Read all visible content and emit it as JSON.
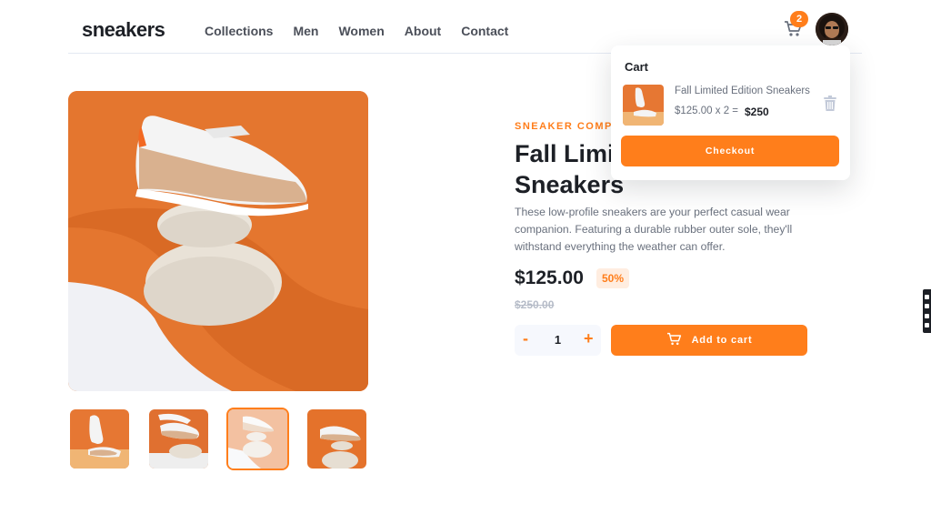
{
  "header": {
    "logo": "sneakers",
    "nav": [
      "Collections",
      "Men",
      "Women",
      "About",
      "Contact"
    ],
    "cart_count": "2",
    "cart_icon": "cart-icon",
    "avatar_icon": "user-avatar"
  },
  "product": {
    "company": "SNEAKER COMPANY",
    "title": "Fall Limited Edition Sneakers",
    "description": "These low-profile sneakers are your perfect casual wear companion. Featuring a durable rubber outer sole, they'll withstand everything the weather can offer.",
    "price": "$125.00",
    "discount": "50%",
    "old_price": "$250.00",
    "quantity": "1",
    "minus": "-",
    "plus": "+",
    "add_to_cart": "Add to cart"
  },
  "cart": {
    "title": "Cart",
    "item_name": "Fall Limited Edition Sneakers",
    "item_calc": "$125.00 x 2 =",
    "item_total": "$250",
    "checkout": "Checkout"
  },
  "colors": {
    "accent": "#ff7e1b",
    "accent_pale": "#ffede0",
    "dark": "#1d2026",
    "grey": "#69707d"
  },
  "thumbnails": {
    "active_index": 2,
    "count": 4
  }
}
